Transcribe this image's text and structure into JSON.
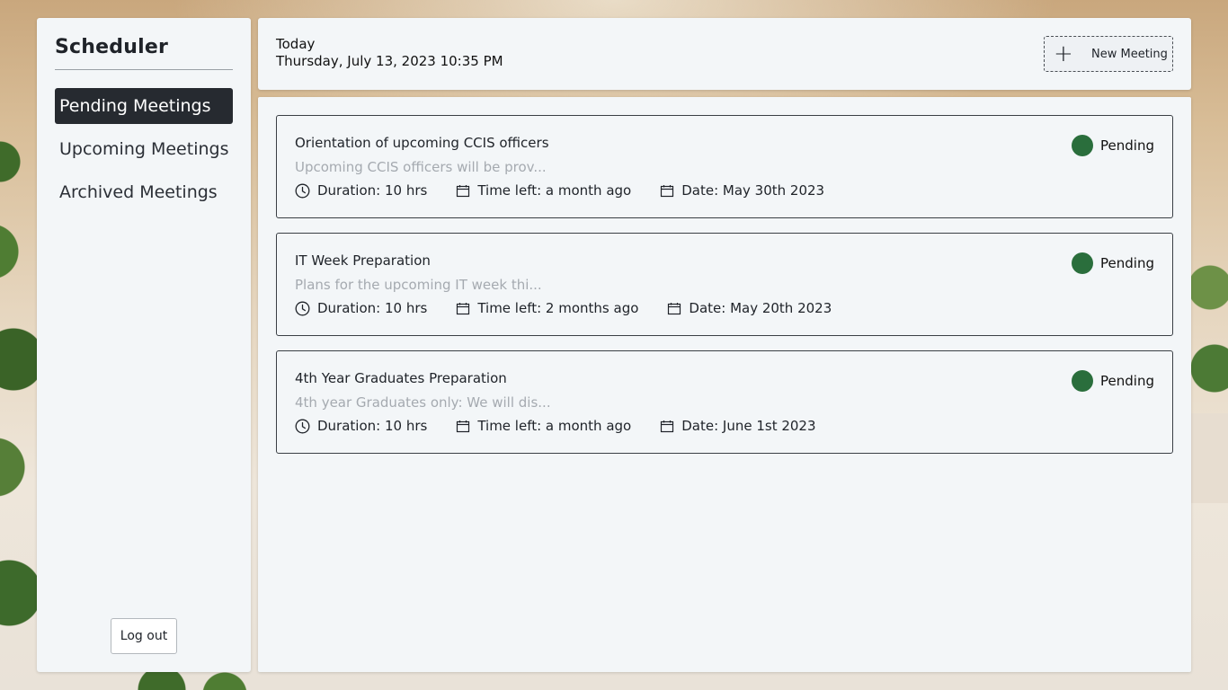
{
  "sidebar": {
    "brand": "Scheduler",
    "items": [
      {
        "label": "Pending Meetings",
        "active": true
      },
      {
        "label": "Upcoming Meetings",
        "active": false
      },
      {
        "label": "Archived Meetings",
        "active": false
      }
    ],
    "logout_label": "Log out"
  },
  "header": {
    "today_label": "Today",
    "today_date": "Thursday, July 13, 2023 10:35 PM",
    "new_meeting_label": "New Meeting",
    "new_meeting_icon": "plus-icon"
  },
  "meetings": [
    {
      "title": "Orientation of upcoming CCIS officers",
      "description": "Upcoming CCIS officers will be prov...",
      "duration": "Duration: 10 hrs",
      "time_left": "Time left: a month ago",
      "date": "Date: May 30th 2023",
      "status": "Pending"
    },
    {
      "title": "IT Week Preparation",
      "description": "Plans for the upcoming IT week thi...",
      "duration": "Duration: 10 hrs",
      "time_left": "Time left: 2 months ago",
      "date": "Date: May 20th 2023",
      "status": "Pending"
    },
    {
      "title": "4th Year Graduates Preparation",
      "description": "4th year Graduates only: We will dis...",
      "duration": "Duration: 10 hrs",
      "time_left": "Time left: a month ago",
      "date": "Date: June 1st 2023",
      "status": "Pending"
    }
  ],
  "colors": {
    "status_pending": "#2a6e3c",
    "nav_active_bg": "#262a30"
  }
}
